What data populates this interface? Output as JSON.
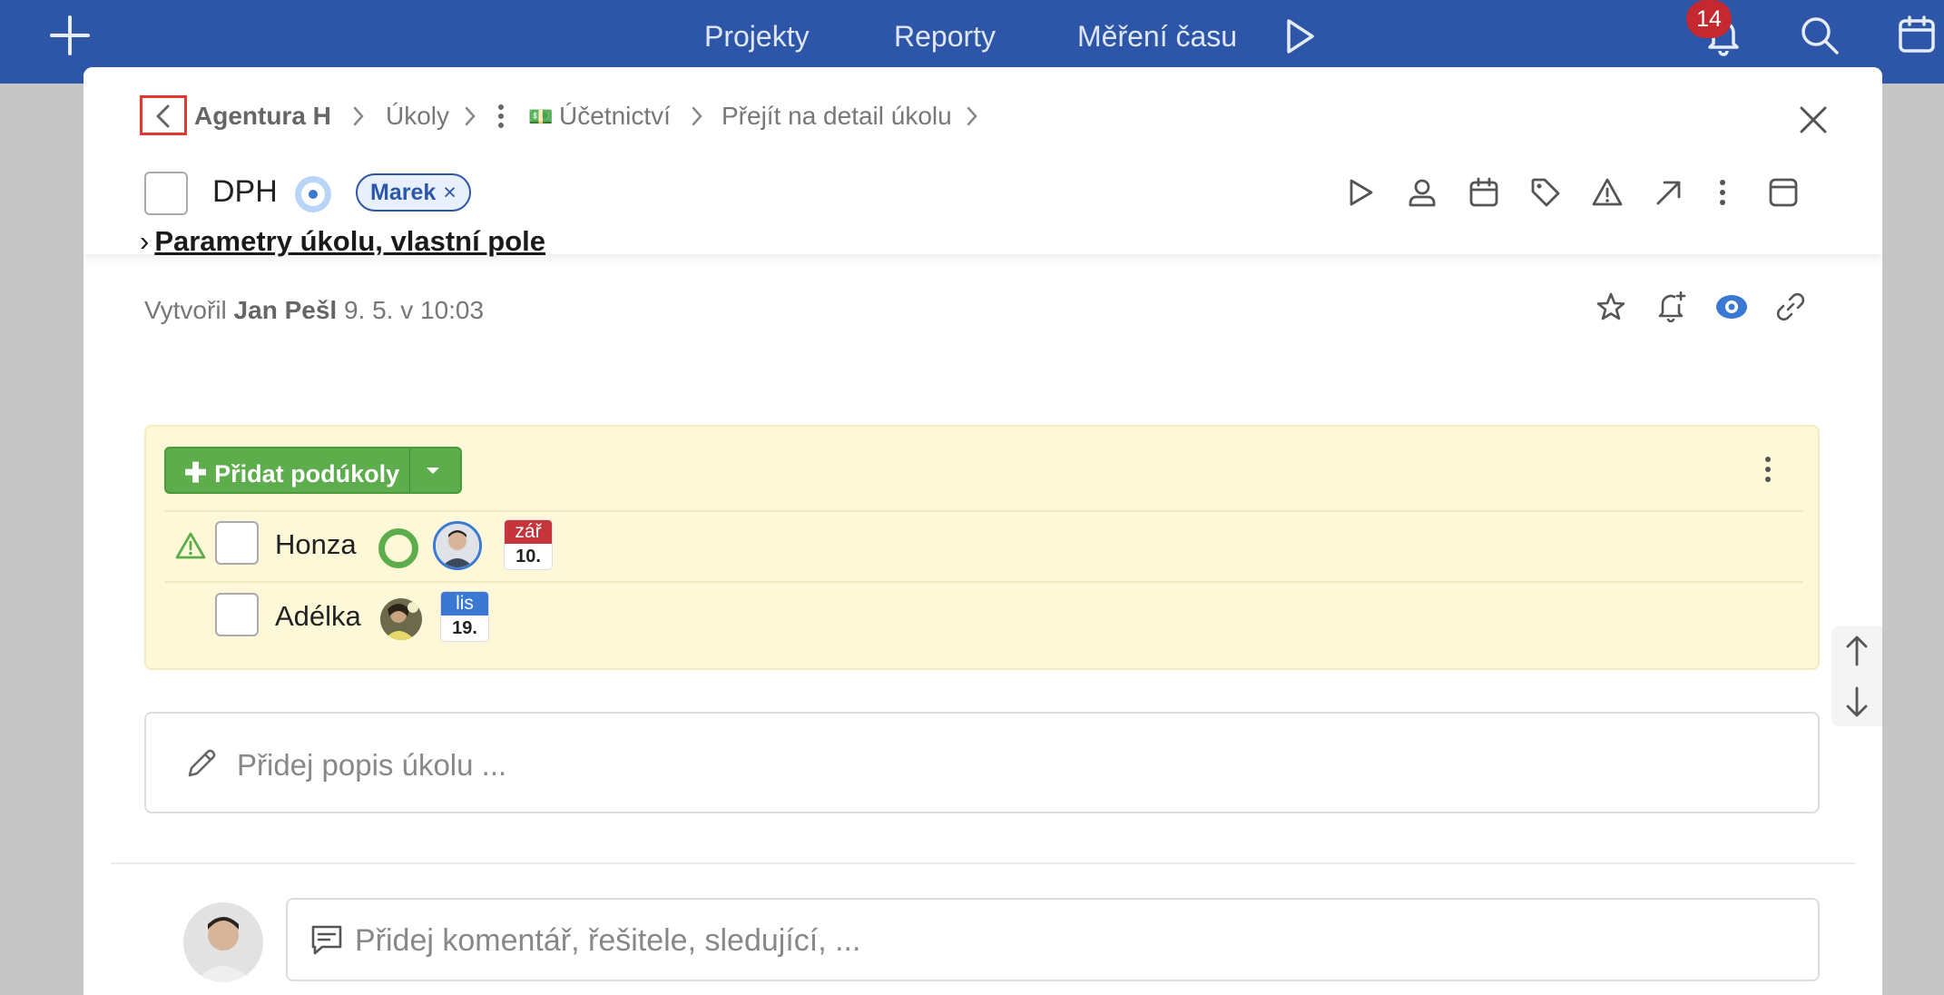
{
  "topbar": {
    "add_icon": "plus-icon",
    "nav": [
      "Projekty",
      "Reporty",
      "Měření času"
    ],
    "play_icon": "play-icon",
    "notifications_count": "14",
    "bell_icon": "bell-icon",
    "search_icon": "search-icon",
    "calendar_icon": "calendar-icon"
  },
  "modal": {
    "breadcrumb": {
      "back_icon": "chevron-left-icon",
      "items": [
        "Agentura H",
        "Úkoly",
        "Účetnictví",
        "Přejít na detail úkolu"
      ],
      "more_icon": "vertical-dots-icon",
      "folder_emoji": "💵"
    },
    "close_icon": "close-icon",
    "task": {
      "title": "DPH",
      "tag": "Marek",
      "tag_remove": "×",
      "toolbar_icons": [
        "play-icon",
        "person-icon",
        "calendar-icon",
        "tag-icon",
        "warning-icon",
        "arrow-up-right-icon",
        "more-icon",
        "panel-icon"
      ]
    },
    "section": {
      "chevron": "›",
      "title": "Parametry úkolu, vlastní pole",
      "icons": [
        "star-icon",
        "bell-plus-icon",
        "eye-icon",
        "link-icon"
      ]
    },
    "created": {
      "prefix": "Vytvořil",
      "author": "Jan Pešl",
      "date": "9. 5. v 10:03"
    },
    "subtasks": {
      "add_label": "Přidat podúkoly",
      "items": [
        {
          "name": "Honza",
          "month": "zář",
          "day": "10.",
          "warning": true,
          "month_color": "#c5353c"
        },
        {
          "name": "Adélka",
          "month": "lis",
          "day": "19.",
          "warning": false,
          "month_color": "#3a78d4"
        }
      ]
    },
    "description": {
      "placeholder": "Přidej popis úkolu ..."
    },
    "comment": {
      "placeholder": "Přidej komentář, řešitele, sledující, ..."
    }
  },
  "colors": {
    "topbar": "#2d56a8",
    "accent_green": "#5dad4c",
    "panel_yellow": "#fdf9d8",
    "highlight_red": "#e03a2f"
  }
}
